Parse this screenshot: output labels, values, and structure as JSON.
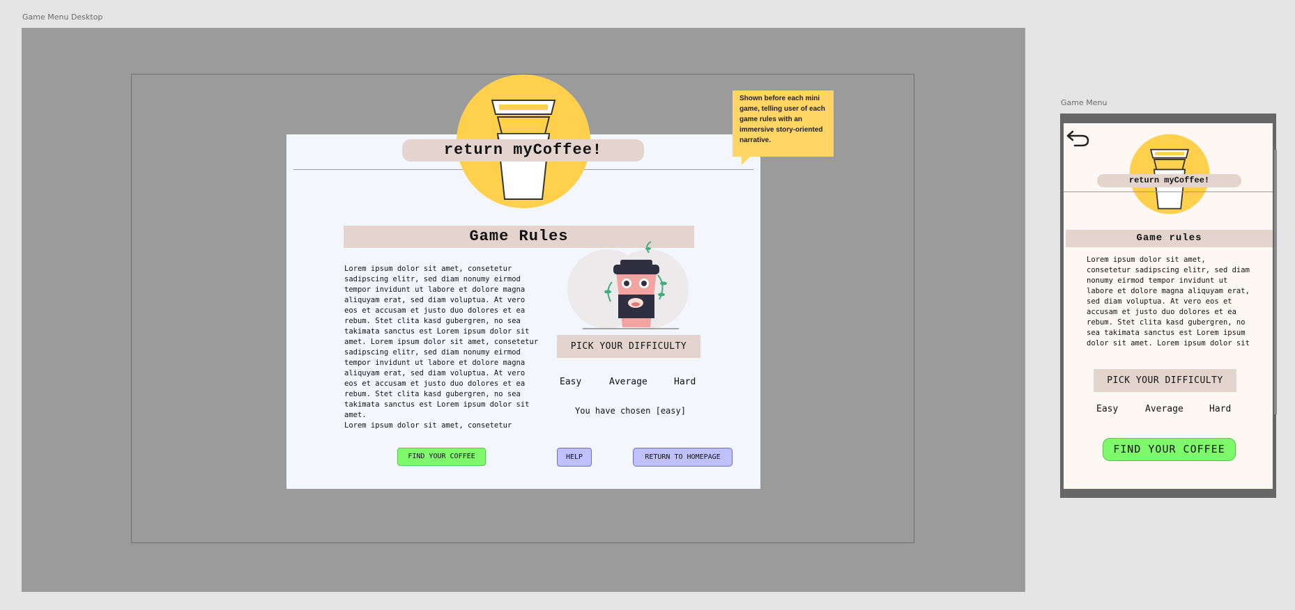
{
  "canvas": {
    "desktop_frame_label": "Game Menu Desktop",
    "mobile_frame_label": "Game Menu"
  },
  "desktop": {
    "app_title": "return myCoffee!",
    "rules_heading": "Game Rules",
    "rules_lines": [
      "Lorem ipsum dolor sit amet, consetetur",
      "sadipscing elitr, sed diam nonumy eirmod",
      "tempor invidunt ut labore et dolore magna",
      "aliquyam erat, sed diam voluptua. At vero",
      "eos et accusam et justo duo dolores et ea",
      "rebum. Stet clita kasd gubergren, no sea",
      "takimata sanctus est Lorem ipsum dolor sit",
      "amet. Lorem ipsum dolor sit amet, consetetur",
      "sadipscing elitr, sed diam nonumy eirmod",
      "tempor invidunt ut labore et dolore magna",
      "aliquyam erat, sed diam voluptua. At vero",
      "eos et accusam et justo duo dolores et ea",
      "rebum. Stet clita kasd gubergren, no sea",
      "takimata sanctus est Lorem ipsum dolor sit",
      "amet.",
      "Lorem ipsum dolor sit amet, consetetur"
    ],
    "difficulty_label": "PICK YOUR DIFFICULTY",
    "difficulty_options": [
      "Easy",
      "Average",
      "Hard"
    ],
    "chosen_text": "You have chosen [easy]",
    "find_button": "FIND YOUR COFFEE",
    "help_button": "HELP",
    "return_button": "RETURN TO HOMEPAGE",
    "sticky_note": "Shown before each mini game, telling user of each game rules with an immersive story-oriented narrative."
  },
  "mobile": {
    "app_title": "return myCoffee!",
    "rules_heading": "Game rules",
    "rules_lines": [
      "Lorem ipsum dolor sit amet,",
      "consetetur sadipscing elitr, sed diam",
      "nonumy eirmod tempor invidunt ut",
      "labore et dolore magna aliquyam erat,",
      "sed diam voluptua. At vero eos et",
      "accusam et justo duo dolores et ea",
      "rebum. Stet clita kasd gubergren, no",
      "sea takimata sanctus est Lorem ipsum",
      "dolor sit amet. Lorem ipsum dolor sit"
    ],
    "difficulty_label": "PICK YOUR DIFFICULTY",
    "difficulty_options": [
      "Easy",
      "Average",
      "Hard"
    ],
    "find_button": "FIND YOUR COFFEE"
  },
  "colors": {
    "artboard_gray": "#9b9b9b",
    "panel": "#f3f6fc",
    "pill": "#e3d5cd",
    "coffee_yellow": "#ffd04c",
    "green_button": "#7ef96b",
    "lavender_button": "#bfc0ff",
    "sticky_note": "#ffd565"
  }
}
